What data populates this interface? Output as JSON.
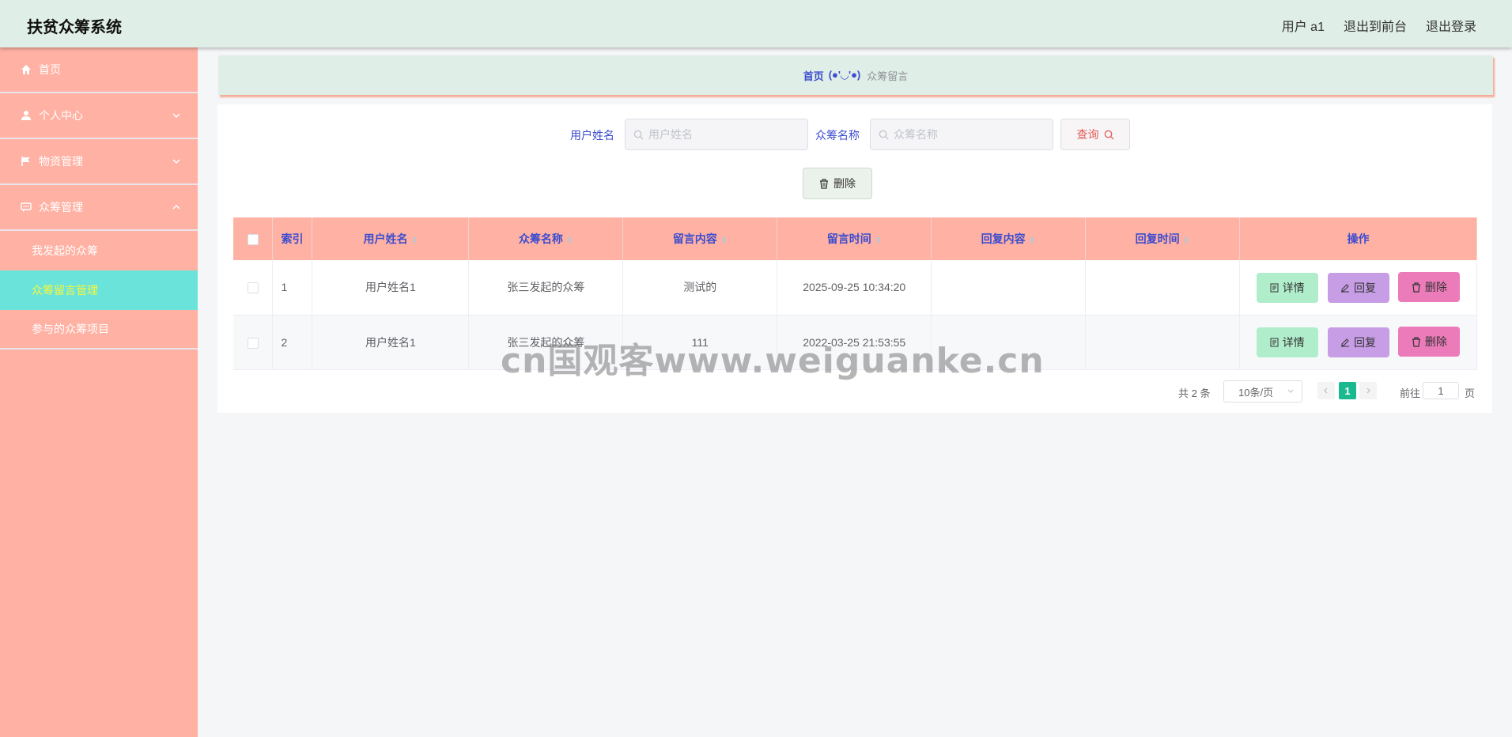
{
  "header": {
    "app_title": "扶贫众筹系统",
    "user_label": "用户 a1",
    "to_front_label": "退出到前台",
    "logout_label": "退出登录"
  },
  "sidebar": {
    "items": [
      {
        "label": "首页",
        "icon": "home-icon"
      },
      {
        "label": "个人中心",
        "icon": "user-icon"
      },
      {
        "label": "物资管理",
        "icon": "flag-icon"
      },
      {
        "label": "众筹管理",
        "icon": "chat-icon"
      }
    ],
    "sub_items": [
      {
        "label": "我发起的众筹"
      },
      {
        "label": "众筹留言管理"
      },
      {
        "label": "参与的众筹项目"
      }
    ]
  },
  "breadcrumb": {
    "home": "首页",
    "separator": "(●'◡'●)",
    "current": "众筹留言"
  },
  "search": {
    "username_label": "用户姓名",
    "username_placeholder": "用户姓名",
    "project_label": "众筹名称",
    "project_placeholder": "众筹名称",
    "query_label": "查询",
    "delete_label": "删除"
  },
  "table": {
    "headers": [
      "索引",
      "用户姓名",
      "众筹名称",
      "留言内容",
      "留言时间",
      "回复内容",
      "回复时间",
      "操作"
    ],
    "rows": [
      {
        "index": "1",
        "username": "用户姓名1",
        "project": "张三发起的众筹",
        "content": "测试的",
        "time": "2025-09-25 10:34:20",
        "reply": "",
        "reply_time": ""
      },
      {
        "index": "2",
        "username": "用户姓名1",
        "project": "张三发起的众筹",
        "content": "111",
        "time": "2022-03-25 21:53:55",
        "reply": "",
        "reply_time": ""
      }
    ],
    "actions": {
      "detail": "详情",
      "reply": "回复",
      "delete": "删除"
    }
  },
  "pagination": {
    "total": "共 2 条",
    "page_size": "10条/页",
    "current_page": "1",
    "goto_label": "前往",
    "goto_value": "1",
    "page_unit": "页"
  },
  "watermark": "cn国观客www.weiguanke.cn",
  "colors": {
    "header_bg": "#dfeee6",
    "sidebar_bg": "#ffb1a3",
    "active_menu_bg": "#6ae3da",
    "active_menu_text": "#f7f73b",
    "accent_text": "#3c4ccf",
    "page_active": "#1bb98f"
  }
}
